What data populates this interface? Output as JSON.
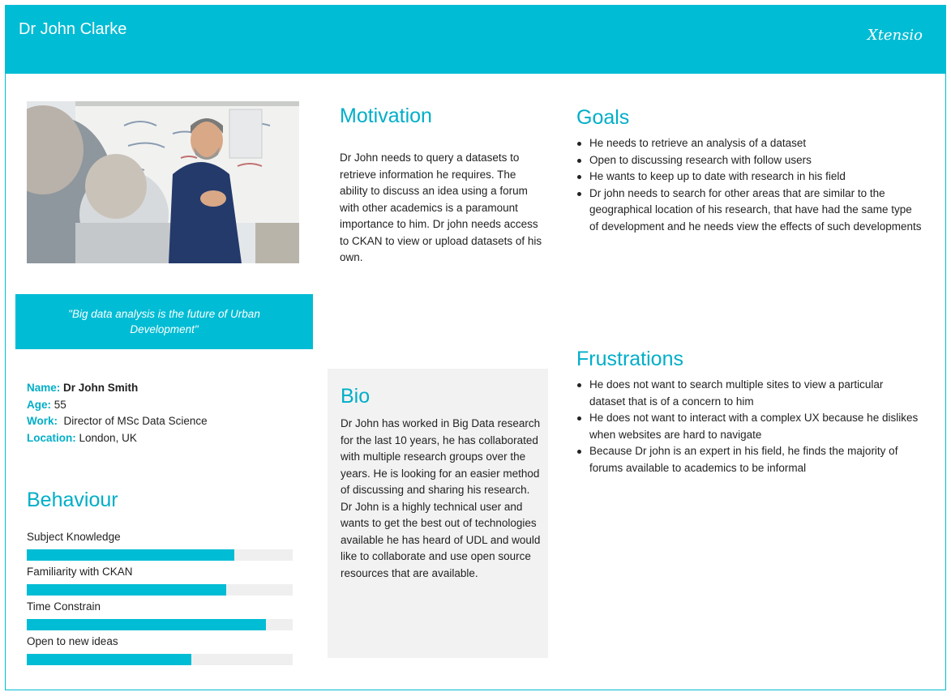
{
  "header": {
    "title": "Dr John Clarke",
    "brand": "Xtensio"
  },
  "quote": "\"Big data analysis is the future of  Urban Development\"",
  "info": {
    "name_label": "Name:",
    "name_value": "Dr John Smith",
    "age_label": "Age:",
    "age_value": "55",
    "work_label": "Work:",
    "work_value": "Director of MSc Data Science",
    "location_label": "Location:",
    "location_value": "London, UK"
  },
  "behaviour": {
    "title": "Behaviour",
    "items": [
      {
        "label": "Subject Knowledge",
        "level": 0.78
      },
      {
        "label": "Familiarity with CKAN",
        "level": 0.75
      },
      {
        "label": "Time Constrain",
        "level": 0.9
      },
      {
        "label": "Open to new ideas",
        "level": 0.62
      }
    ]
  },
  "motivation": {
    "title": "Motivation",
    "text": "Dr John needs to query a datasets to retrieve information he requires. The ability to discuss an idea using a forum with other academics is a paramount importance to him. Dr john needs access to CKAN to view or upload datasets of his own."
  },
  "bio": {
    "title": "Bio",
    "text": "Dr John has worked in Big Data research for the last 10 years, he has collaborated with multiple research groups over the years. He is looking for an easier method of discussing and sharing his research. Dr John is a highly technical user and wants to get the best out of technologies available he has heard of UDL and would like to collaborate and use open source resources that are available."
  },
  "goals": {
    "title": "Goals",
    "items": [
      "He needs to retrieve an analysis of a dataset",
      "Open to discussing research with follow users",
      "He wants to keep up to date with research in his field",
      "Dr john needs to search for other areas that are similar to the geographical location of his research, that have had the same type of  development and he needs view the effects of such developments"
    ]
  },
  "frustrations": {
    "title": "Frustrations",
    "items": [
      "He does not want to search multiple sites to view a particular dataset that is of a concern to him",
      "He does not want to interact with a complex UX because he dislikes when websites are hard to navigate",
      "Because Dr john is an expert in his field, he finds the majority of forums available to academics to be informal"
    ]
  },
  "colors": {
    "accent": "#00bcd4",
    "track": "#efefef",
    "bio_bg": "#f2f2f2"
  }
}
